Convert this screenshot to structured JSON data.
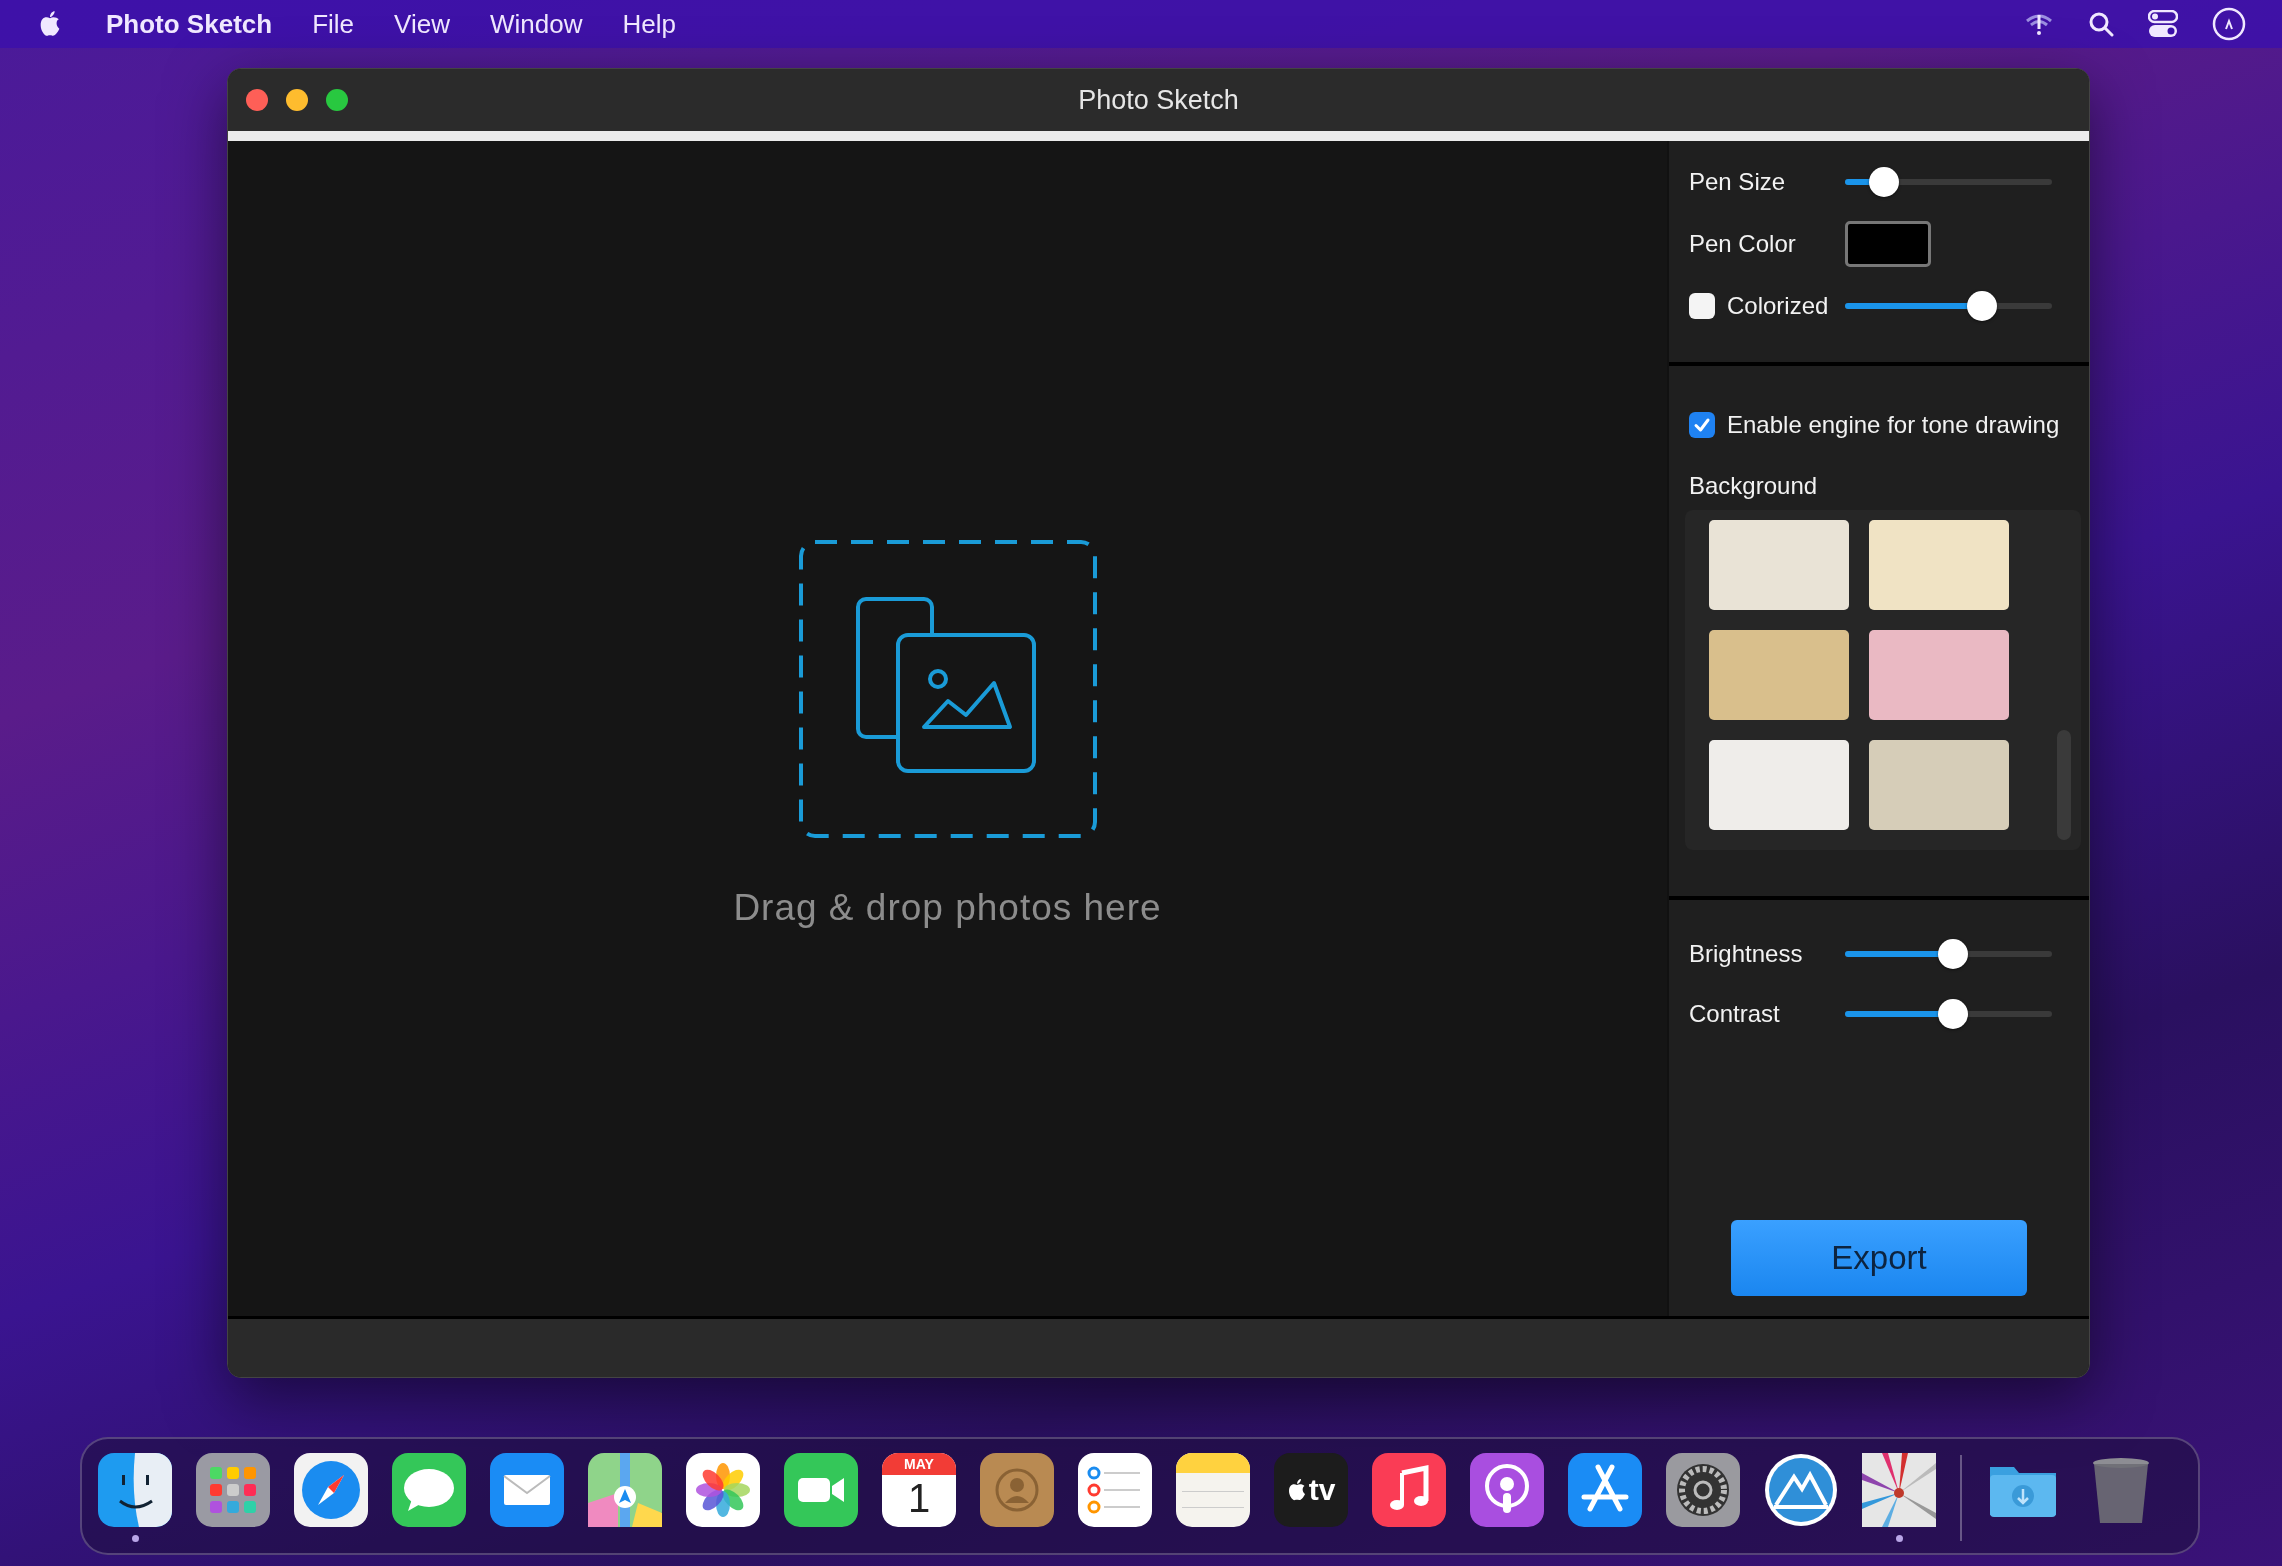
{
  "menu_bar": {
    "app_name": "Photo Sketch",
    "menus": [
      "File",
      "View",
      "Window",
      "Help"
    ]
  },
  "window": {
    "title": "Photo Sketch"
  },
  "drop_zone": {
    "text": "Drag & drop photos here"
  },
  "controls": {
    "pen_size": {
      "label": "Pen Size",
      "level": 0.19
    },
    "pen_color": {
      "label": "Pen Color",
      "color": "#000000"
    },
    "colorized": {
      "label": "Colorized",
      "checked": false,
      "level": 0.66
    },
    "tone_engine": {
      "label": "Enable engine for tone drawing",
      "checked": true
    },
    "background": {
      "label": "Background",
      "swatches": [
        {
          "color": "#e9e3d6"
        },
        {
          "color": "#f0e3c4"
        },
        {
          "color": "#d9bf8c"
        },
        {
          "color": "#eab9c3"
        },
        {
          "color": "#efedea"
        },
        {
          "color": "#d6cdb8"
        }
      ]
    },
    "brightness": {
      "label": "Brightness",
      "level": 0.52
    },
    "contrast": {
      "label": "Contrast",
      "level": 0.52
    }
  },
  "export_button": {
    "label": "Export"
  },
  "dock": [
    {
      "kind": "finder",
      "running": true
    },
    {
      "kind": "launchpad",
      "running": false
    },
    {
      "kind": "safari",
      "running": false
    },
    {
      "kind": "messages",
      "running": false
    },
    {
      "kind": "mail",
      "running": false
    },
    {
      "kind": "maps",
      "running": false
    },
    {
      "kind": "photos",
      "running": false
    },
    {
      "kind": "facetime",
      "running": false
    },
    {
      "kind": "calendar",
      "running": false,
      "month": "MAY",
      "day": "1"
    },
    {
      "kind": "contacts",
      "running": false
    },
    {
      "kind": "reminders",
      "running": false
    },
    {
      "kind": "notes",
      "running": false
    },
    {
      "kind": "tv",
      "running": false,
      "label": "tv"
    },
    {
      "kind": "music",
      "running": false
    },
    {
      "kind": "podcasts",
      "running": false
    },
    {
      "kind": "appstore",
      "running": false
    },
    {
      "kind": "settings",
      "running": false
    },
    {
      "kind": "mountain",
      "running": false
    },
    {
      "kind": "photosketch",
      "running": true
    },
    {
      "kind": "divider"
    },
    {
      "kind": "downloads",
      "running": false
    },
    {
      "kind": "trash",
      "running": false
    }
  ]
}
